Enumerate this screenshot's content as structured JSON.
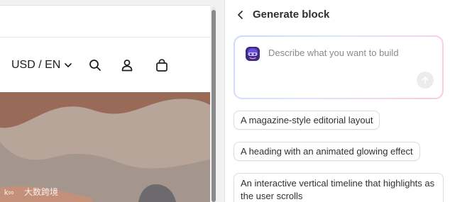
{
  "store": {
    "locale_label": "USD / EN",
    "icons": [
      "search-icon",
      "account-icon",
      "cart-icon"
    ],
    "hero_colors": [
      "#9a6a59",
      "#b7a59a",
      "#a4968c",
      "#c4907a"
    ],
    "watermark": "大数跨境"
  },
  "panel": {
    "title": "Generate block",
    "prompt_placeholder": "Describe what you want to build",
    "prompt_value": "",
    "suggestions": [
      "A magazine-style editorial layout",
      "A heading with an animated glowing effect",
      "An interactive vertical timeline that highlights as the user scrolls"
    ]
  },
  "colors": {
    "panel_bg": "#ffffff",
    "page_bg": "#f1f1f1",
    "text": "#303030",
    "placeholder": "#8a8a8a"
  }
}
